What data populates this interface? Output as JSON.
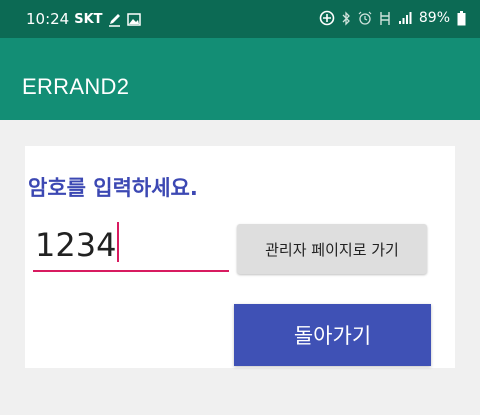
{
  "status_bar": {
    "time": "10:24",
    "carrier": "SKT",
    "battery": "89%",
    "left_icons": [
      "edit-icon",
      "image-icon"
    ],
    "right_icons": [
      "sync-icon",
      "bluetooth-icon",
      "alarm-icon",
      "lte-icon",
      "signal-icon",
      "battery-icon"
    ]
  },
  "app_bar": {
    "title": "ERRAND2"
  },
  "form": {
    "prompt_label": "암호를 입력하세요.",
    "password_value": "1234",
    "admin_button_label": "관리자 페이지로 가기",
    "back_button_label": "돌아가기"
  },
  "colors": {
    "status_bar": "#0c6a54",
    "app_bar": "#138e75",
    "accent": "#3f51b5",
    "underline": "#d81b60"
  }
}
